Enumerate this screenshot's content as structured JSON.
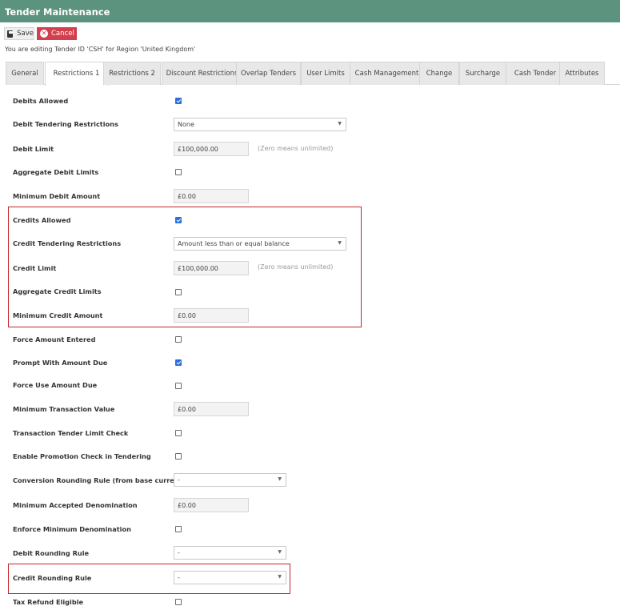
{
  "window": {
    "title": "Tender Maintenance"
  },
  "toolbar": {
    "save_label": "Save",
    "cancel_label": "Cancel"
  },
  "editing_text": "You are editing Tender ID 'CSH' for Region 'United Kingdom'",
  "tabs": [
    {
      "label": "General",
      "active": false
    },
    {
      "label": "Restrictions 1",
      "active": true
    },
    {
      "label": "Restrictions 2",
      "active": false
    },
    {
      "label": "Discount Restrictions",
      "active": false
    },
    {
      "label": "Overlap Tenders",
      "active": false
    },
    {
      "label": "User Limits",
      "active": false
    },
    {
      "label": "Cash Management",
      "active": false
    },
    {
      "label": "Change",
      "active": false
    },
    {
      "label": "Surcharge",
      "active": false
    },
    {
      "label": "Cash Tender",
      "active": false
    },
    {
      "label": "Attributes",
      "active": false
    }
  ],
  "hint_text": "(Zero means unlimited)",
  "fields": {
    "debits_allowed": {
      "label": "Debits Allowed",
      "checked": true
    },
    "debit_tendering_restrictions": {
      "label": "Debit Tendering Restrictions",
      "value": "None"
    },
    "debit_limit": {
      "label": "Debit Limit",
      "value": "£100,000.00"
    },
    "aggregate_debit_limits": {
      "label": "Aggregate Debit Limits",
      "checked": false
    },
    "minimum_debit_amount": {
      "label": "Minimum Debit Amount",
      "value": "£0.00"
    },
    "credits_allowed": {
      "label": "Credits Allowed",
      "checked": true
    },
    "credit_tendering_restrictions": {
      "label": "Credit Tendering Restrictions",
      "value": "Amount less than or equal balance"
    },
    "credit_limit": {
      "label": "Credit Limit",
      "value": "£100,000.00"
    },
    "aggregate_credit_limits": {
      "label": "Aggregate Credit Limits",
      "checked": false
    },
    "minimum_credit_amount": {
      "label": "Minimum Credit Amount",
      "value": "£0.00"
    },
    "force_amount_entered": {
      "label": "Force Amount Entered",
      "checked": false
    },
    "prompt_with_amount_due": {
      "label": "Prompt With Amount Due",
      "checked": true
    },
    "force_use_amount_due": {
      "label": "Force Use Amount Due",
      "checked": false
    },
    "minimum_transaction_value": {
      "label": "Minimum Transaction Value",
      "value": "£0.00"
    },
    "transaction_tender_limit_check": {
      "label": "Transaction Tender Limit Check",
      "checked": false
    },
    "enable_promotion_check": {
      "label": "Enable Promotion Check in Tendering",
      "checked": false
    },
    "conversion_rounding_rule": {
      "label": "Conversion Rounding Rule (from base currency)",
      "value": "-"
    },
    "minimum_accepted_denomination": {
      "label": "Minimum Accepted Denomination",
      "value": "£0.00"
    },
    "enforce_minimum_denomination": {
      "label": "Enforce Minimum Denomination",
      "checked": false
    },
    "debit_rounding_rule": {
      "label": "Debit Rounding Rule",
      "value": "-"
    },
    "credit_rounding_rule": {
      "label": "Credit Rounding Rule",
      "value": "-"
    },
    "tax_refund_eligible": {
      "label": "Tax Refund Eligible",
      "checked": false
    }
  },
  "colors": {
    "title_bar": "#5b937f",
    "cancel_button": "#d1404e",
    "checkbox_checked": "#2a6fdb",
    "highlight_border": "#c0272d"
  }
}
